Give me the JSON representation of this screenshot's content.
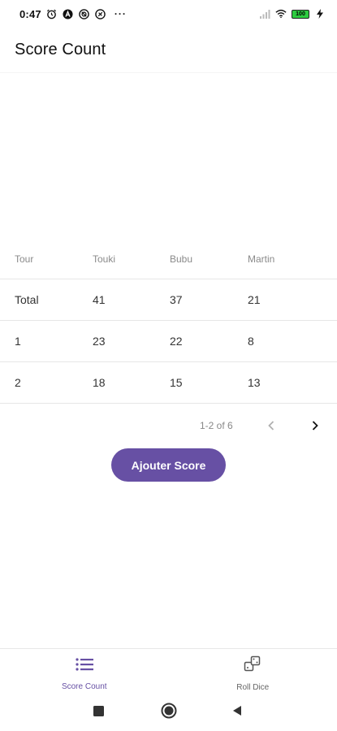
{
  "status_bar": {
    "time": "0:47",
    "battery_label": "100",
    "left_icons": [
      "alarm-icon",
      "notification-a-icon",
      "notification-icon",
      "notification-icon"
    ],
    "right_icons": [
      "signal-icon",
      "wifi-icon",
      "battery-icon",
      "charging-icon"
    ],
    "overflow": "···"
  },
  "app_bar": {
    "title": "Score Count"
  },
  "table": {
    "headers": [
      "Tour",
      "Touki",
      "Bubu",
      "Martin"
    ],
    "rows": [
      [
        "Total",
        "41",
        "37",
        "21"
      ],
      [
        "1",
        "23",
        "22",
        "8"
      ],
      [
        "2",
        "18",
        "15",
        "13"
      ]
    ]
  },
  "pagination": {
    "info": "1-2 of 6",
    "prev_icon": "chevron-left-icon",
    "next_icon": "chevron-right-icon"
  },
  "actions": {
    "add_score_label": "Ajouter Score"
  },
  "bottom_nav": {
    "items": [
      {
        "label": "Score Count",
        "icon": "list-icon",
        "active": true
      },
      {
        "label": "Roll Dice",
        "icon": "dice-icon",
        "active": false
      }
    ]
  },
  "system_nav": {
    "buttons": [
      "recents-icon",
      "home-icon",
      "back-icon"
    ]
  },
  "colors": {
    "accent": "#6750a4",
    "background": "#ffffff",
    "divider": "#e6e6e6",
    "battery": "#2ecc40"
  }
}
